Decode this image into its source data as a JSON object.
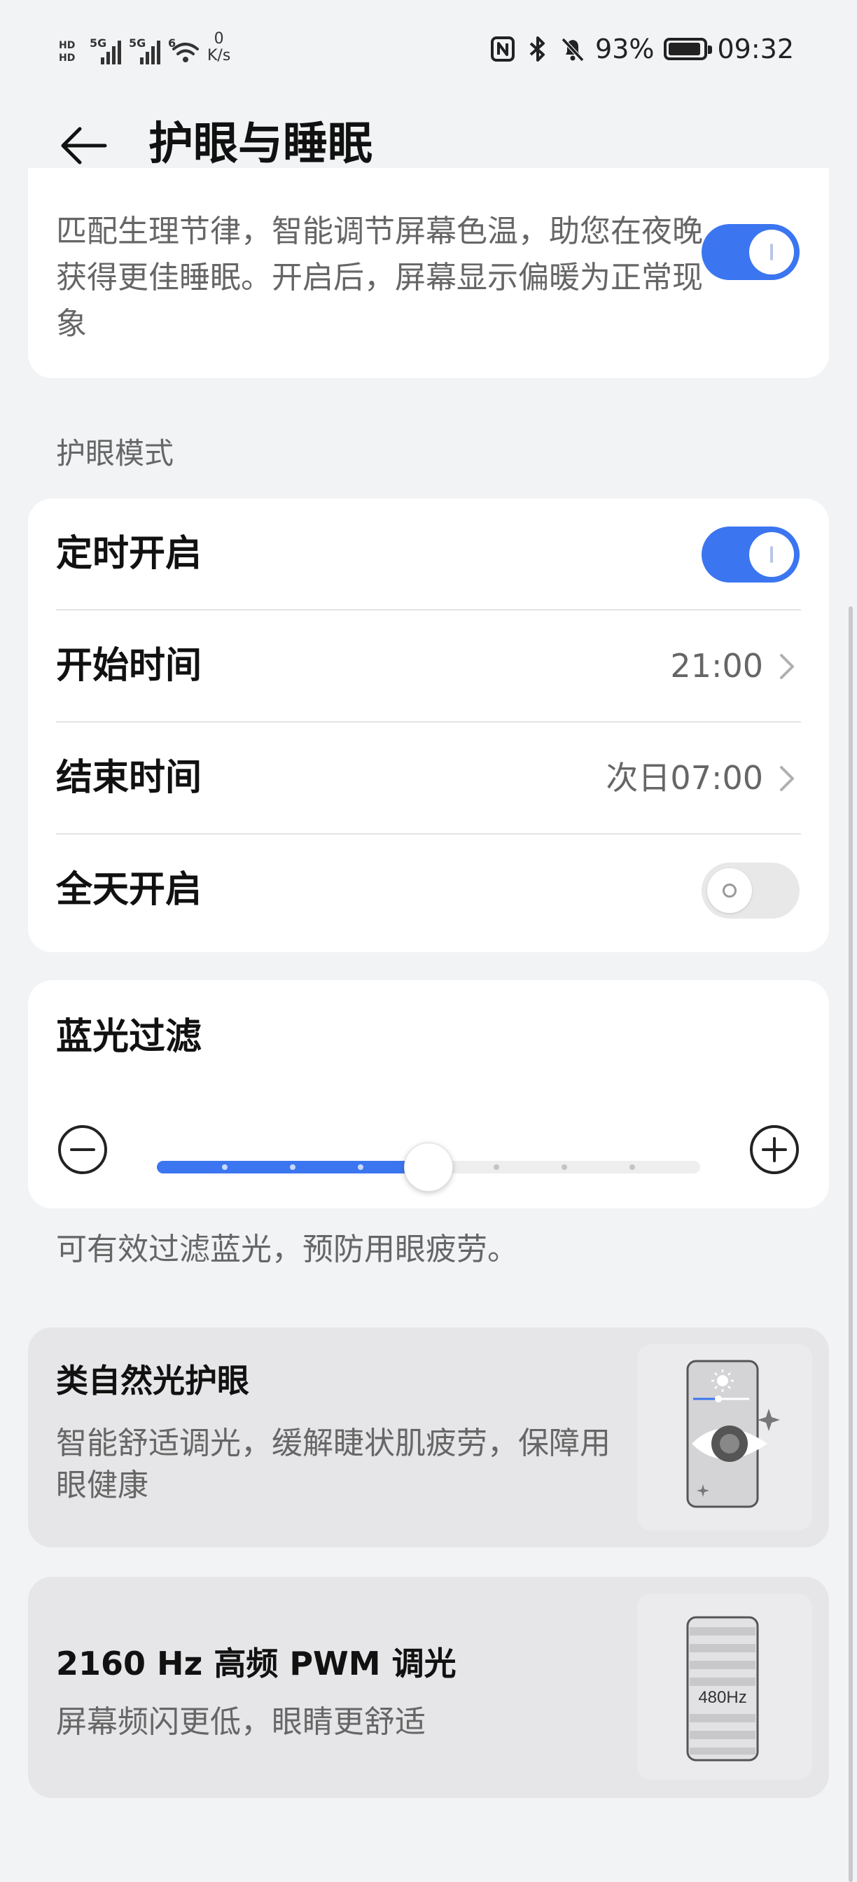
{
  "status_bar": {
    "hd_1": "HD",
    "hd_2": "HD",
    "sim1_label": "5G",
    "sim2_label": "5G",
    "wifi_label": "6",
    "net_speed_value": "0",
    "net_speed_unit": "K/s",
    "battery_percent": "93%",
    "battery_level": 0.93,
    "time": "09:32",
    "icons": [
      "nfc-icon",
      "bluetooth-icon",
      "mute-bell-icon",
      "battery-icon"
    ]
  },
  "header": {
    "title": "护眼与睡眠",
    "back_icon": "arrow-left-icon"
  },
  "top_card": {
    "description": "匹配生理节律，智能调节屏幕色温，助您在夜晚获得更佳睡眠。开启后，屏幕显示偏暖为正常现象",
    "toggle_on": true
  },
  "eye_mode": {
    "section_label": "护眼模式",
    "rows": [
      {
        "label": "定时开启",
        "type": "toggle",
        "on": true
      },
      {
        "label": "开始时间",
        "type": "value",
        "value": "21:00"
      },
      {
        "label": "结束时间",
        "type": "value",
        "value": "次日07:00"
      },
      {
        "label": "全天开启",
        "type": "toggle",
        "on": false
      }
    ]
  },
  "blue_light": {
    "title": "蓝光过滤",
    "level": 0.5,
    "steps": 8,
    "hint": "可有效过滤蓝光，预防用眼疲劳。",
    "accent": "#3b76f0"
  },
  "promos": [
    {
      "title": "类自然光护眼",
      "description": "智能舒适调光，缓解睫状肌疲劳，保障用眼健康",
      "image_icon": "phone-eye-icon"
    },
    {
      "title": "2160 Hz 高频 PWM 调光",
      "description": "屏幕频闪更低，眼睛更舒适",
      "image_icon": "phone-pwm-icon",
      "image_label": "480Hz"
    }
  ],
  "colors": {
    "accent": "#3b76f0",
    "background": "#f1f3f5",
    "card": "#ffffff",
    "promo_card": "#e6e6e8"
  }
}
